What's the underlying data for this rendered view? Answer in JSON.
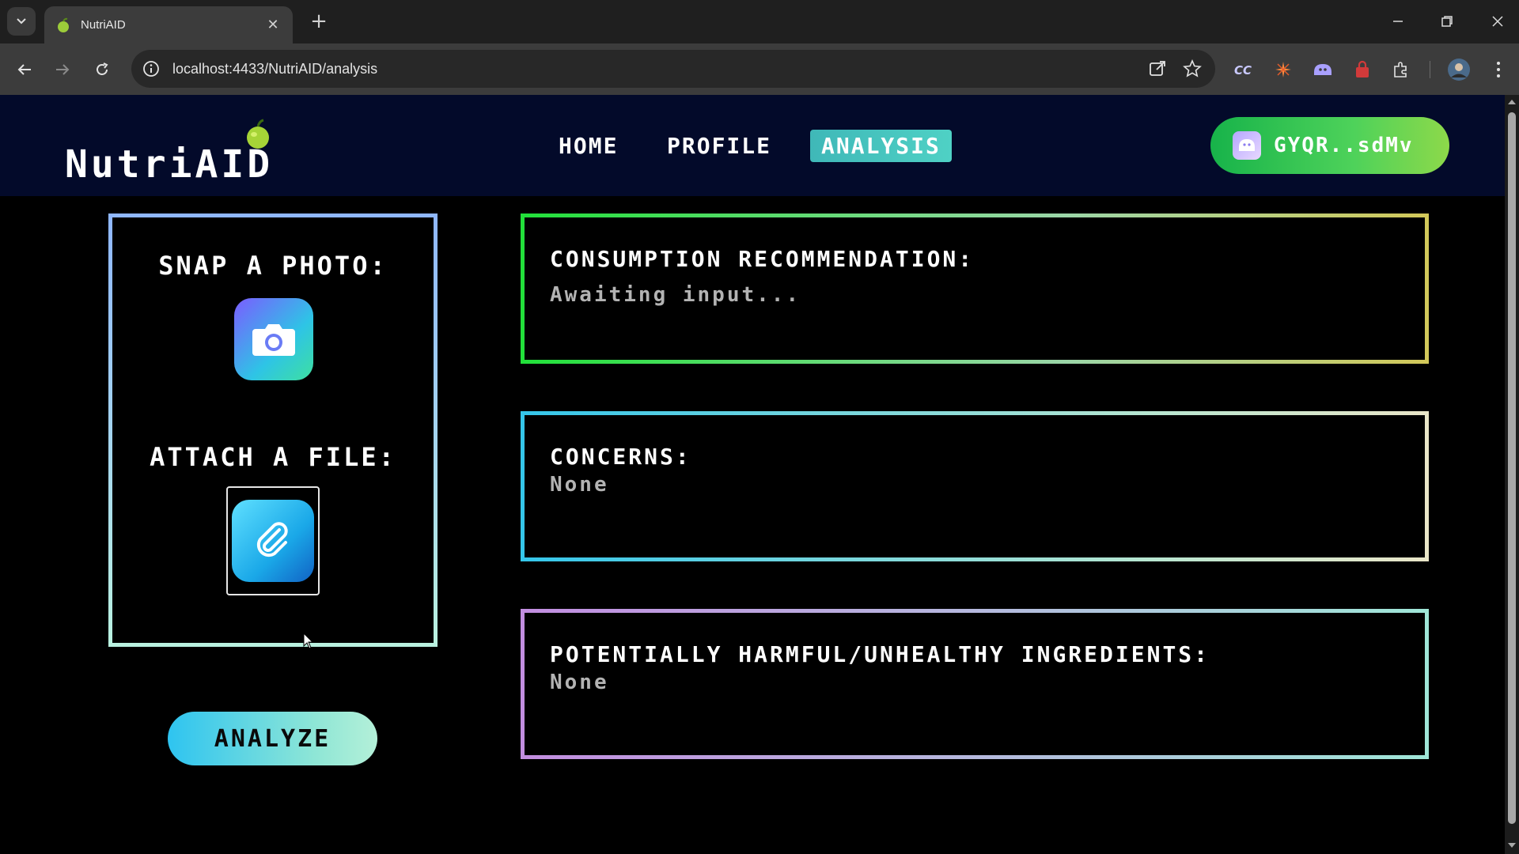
{
  "browser": {
    "tab_title": "NutriAID",
    "url": "localhost:4433/NutriAID/analysis"
  },
  "header": {
    "logo_text": "NutriAID",
    "nav": [
      {
        "label": "HOME",
        "active": false
      },
      {
        "label": "PROFILE",
        "active": false
      },
      {
        "label": "ANALYSIS",
        "active": true
      }
    ],
    "wallet_label": "GYQR..sdMv"
  },
  "input_panel": {
    "snap_heading": "SNAP A PHOTO:",
    "attach_heading": "ATTACH A FILE:"
  },
  "analyze_label": "ANALYZE",
  "results": {
    "consumption": {
      "title": "CONSUMPTION RECOMMENDATION:",
      "value": "Awaiting input..."
    },
    "concerns": {
      "title": "CONCERNS:",
      "value": "None"
    },
    "harmful": {
      "title": "POTENTIALLY HARMFUL/UNHEALTHY INGREDIENTS:",
      "value": "None"
    }
  },
  "colors": {
    "header_bg": "#030a2a",
    "active_nav": "#4fd1c5",
    "wallet_green": "#4ed25a"
  }
}
